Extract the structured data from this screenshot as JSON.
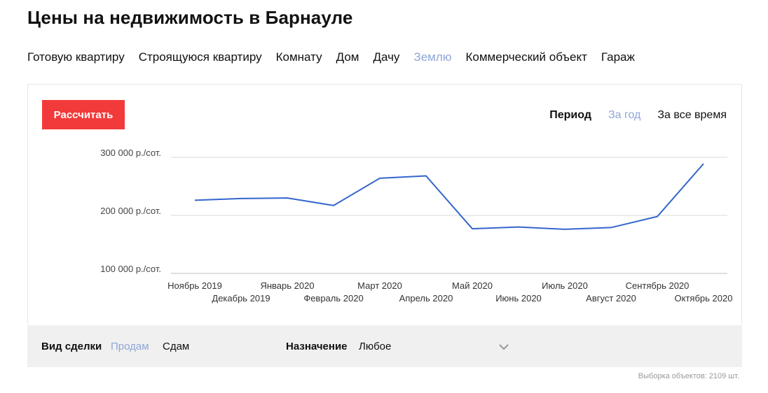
{
  "page": {
    "title": "Цены на недвижимость в Барнауле"
  },
  "tabs": [
    {
      "label": "Готовую квартиру",
      "active": false
    },
    {
      "label": "Строящуюся квартиру",
      "active": false
    },
    {
      "label": "Комнату",
      "active": false
    },
    {
      "label": "Дом",
      "active": false
    },
    {
      "label": "Дачу",
      "active": false
    },
    {
      "label": "Землю",
      "active": true
    },
    {
      "label": "Коммерческий объект",
      "active": false
    },
    {
      "label": "Гараж",
      "active": false
    }
  ],
  "calc_button": {
    "label": "Рассчитать"
  },
  "period": {
    "label": "Период",
    "options": [
      {
        "label": "За год",
        "active": true
      },
      {
        "label": "За все время",
        "active": false
      }
    ]
  },
  "chart_data": {
    "type": "line",
    "title": "",
    "xlabel": "",
    "ylabel": "",
    "categories": [
      "Ноябрь 2019",
      "Декабрь 2019",
      "Январь 2020",
      "Февраль 2020",
      "Март 2020",
      "Апрель 2020",
      "Май 2020",
      "Июнь 2020",
      "Июль 2020",
      "Август 2020",
      "Сентябрь 2020",
      "Октябрь 2020"
    ],
    "series": [
      {
        "name": "",
        "values": [
          226000,
          229000,
          230000,
          217000,
          264000,
          268000,
          177000,
          180000,
          176000,
          179000,
          198000,
          289000
        ]
      }
    ],
    "y_ticks": [
      {
        "value": 100000,
        "label": "100 000 р./сот."
      },
      {
        "value": 200000,
        "label": "200 000 р./сот."
      },
      {
        "value": 300000,
        "label": "300 000 р./сот."
      }
    ],
    "ylim": [
      100000,
      300000
    ],
    "grid": true,
    "legend": "none",
    "line_color": "#3366cc",
    "grid_color": "#d9d9d9"
  },
  "filters": {
    "deal_type": {
      "label": "Вид сделки",
      "options": [
        {
          "label": "Продам",
          "active": true
        },
        {
          "label": "Сдам",
          "active": false
        }
      ]
    },
    "purpose": {
      "label": "Назначение",
      "value": "Любое"
    }
  },
  "footer": {
    "sample_text": "Выборка объектов: 2109 шт."
  },
  "colors": {
    "accent": "#f33a3a",
    "active_link": "#8fa6d6",
    "filter_bg": "#f0f0f0"
  }
}
